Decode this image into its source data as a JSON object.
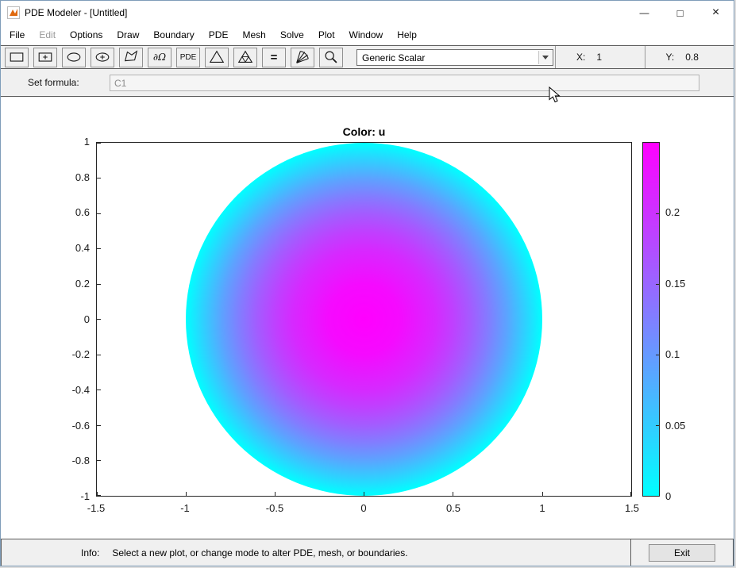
{
  "window": {
    "title": "PDE Modeler - [Untitled]",
    "controls": {
      "minimize_glyph": "—",
      "maximize_glyph": "□",
      "close_glyph": "×"
    }
  },
  "menu": {
    "items": [
      "File",
      "Edit",
      "Options",
      "Draw",
      "Boundary",
      "PDE",
      "Mesh",
      "Solve",
      "Plot",
      "Window",
      "Help"
    ],
    "disabled_item": "Edit"
  },
  "toolbar": {
    "boundary_mode_glyph": "∂Ω",
    "pde_mode_label": "PDE",
    "solve_glyph": "=",
    "mode_dropdown": {
      "value": "Generic Scalar"
    },
    "coords": {
      "x_label": "X:",
      "x_value": "1",
      "y_label": "Y:",
      "y_value": "0.8"
    }
  },
  "formula": {
    "label": "Set formula:",
    "value": "C1"
  },
  "plot": {
    "title": "Color: u",
    "x_tick_labels": [
      "-1.5",
      "-1",
      "-0.5",
      "0",
      "0.5",
      "1",
      "1.5"
    ],
    "y_tick_labels": [
      "1",
      "0.8",
      "0.6",
      "0.4",
      "0.2",
      "0",
      "-0.2",
      "-0.4",
      "-0.6",
      "-0.8",
      "-1"
    ],
    "colorbar_tick_labels": [
      "0.2",
      "0.15",
      "0.1",
      "0.05",
      "0"
    ]
  },
  "chart_data": {
    "type": "heatmap",
    "title": "Color: u",
    "xlim": [
      -1.5,
      1.5
    ],
    "ylim": [
      -1,
      1
    ],
    "x_ticks": [
      -1.5,
      -1,
      -0.5,
      0,
      0.5,
      1,
      1.5
    ],
    "y_ticks": [
      -1,
      -0.8,
      -0.6,
      -0.4,
      -0.2,
      0,
      0.2,
      0.4,
      0.6,
      0.8,
      1
    ],
    "geometry": {
      "shape": "circle",
      "center": [
        0,
        0
      ],
      "radius": 1
    },
    "solution": "u(r) = (1 - r^2)/4; u = 0.25 at center, 0 at boundary, radially symmetric",
    "colormap": {
      "name": "cool",
      "low_color": "#00ffff",
      "high_color": "#ff00ff"
    },
    "colorbar": {
      "range": [
        0,
        0.25
      ],
      "ticks": [
        0,
        0.05,
        0.1,
        0.15,
        0.2
      ],
      "position": "right"
    },
    "grid": false,
    "legend": null
  },
  "statusbar": {
    "info_label": "Info:",
    "message": "Select a new plot, or change mode to alter PDE, mesh, or boundaries.",
    "exit_label": "Exit"
  }
}
